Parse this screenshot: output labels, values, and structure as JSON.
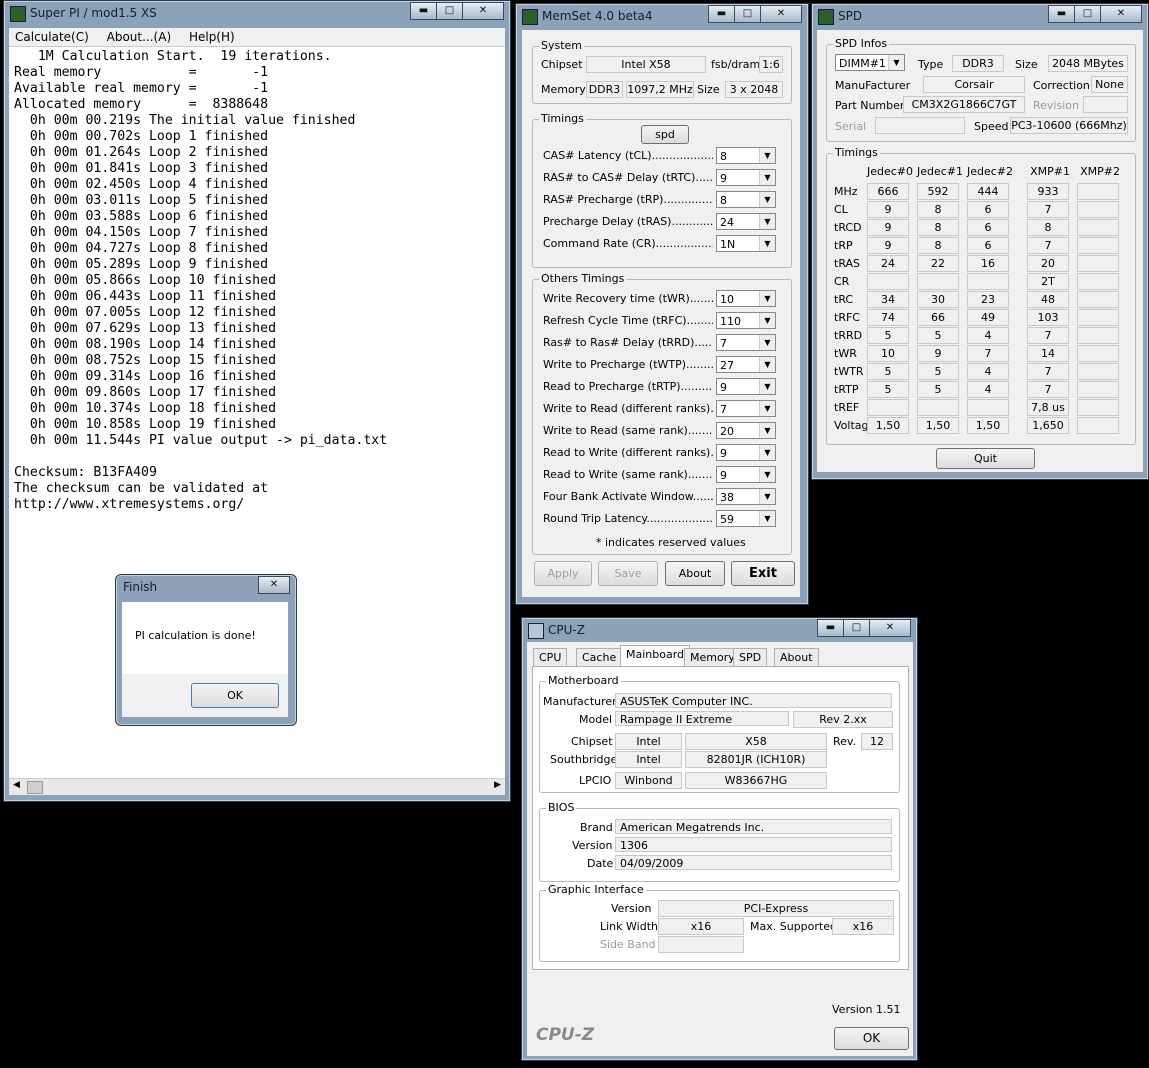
{
  "superpi": {
    "title": "Super PI / mod1.5 XS",
    "menu": [
      "Calculate(C)",
      "About...(A)",
      "Help(H)"
    ],
    "lines": [
      "   1M Calculation Start.  19 iterations.",
      "Real memory           =       -1",
      "Available real memory =       -1",
      "Allocated memory      =  8388648",
      "  0h 00m 00.219s The initial value finished",
      "  0h 00m 00.702s Loop 1 finished",
      "  0h 00m 01.264s Loop 2 finished",
      "  0h 00m 01.841s Loop 3 finished",
      "  0h 00m 02.450s Loop 4 finished",
      "  0h 00m 03.011s Loop 5 finished",
      "  0h 00m 03.588s Loop 6 finished",
      "  0h 00m 04.150s Loop 7 finished",
      "  0h 00m 04.727s Loop 8 finished",
      "  0h 00m 05.289s Loop 9 finished",
      "  0h 00m 05.866s Loop 10 finished",
      "  0h 00m 06.443s Loop 11 finished",
      "  0h 00m 07.005s Loop 12 finished",
      "  0h 00m 07.629s Loop 13 finished",
      "  0h 00m 08.190s Loop 14 finished",
      "  0h 00m 08.752s Loop 15 finished",
      "  0h 00m 09.314s Loop 16 finished",
      "  0h 00m 09.860s Loop 17 finished",
      "  0h 00m 10.374s Loop 18 finished",
      "  0h 00m 10.858s Loop 19 finished",
      "  0h 00m 11.544s PI value output -> pi_data.txt",
      "",
      "Checksum: B13FA409",
      "The checksum can be validated at",
      "http://www.xtremesystems.org/"
    ]
  },
  "finish": {
    "title": "Finish",
    "message": "PI calculation is done!",
    "ok": "OK"
  },
  "memset": {
    "title": "MemSet 4.0 beta4",
    "system": {
      "group": "System",
      "chipset_label": "Chipset",
      "chipset": "Intel X58",
      "fsb_label": "fsb/dram",
      "fsb": "1:6",
      "memory_label": "Memory",
      "memory_type": "DDR3",
      "memory_freq": "1097,2 MHz",
      "size_label": "Size",
      "size": "3 x 2048"
    },
    "timings": {
      "group": "Timings",
      "spd_button": "spd",
      "rows": [
        {
          "label": "CAS# Latency (tCL)",
          "value": "8"
        },
        {
          "label": "RAS# to CAS# Delay (tRTC)",
          "value": "9"
        },
        {
          "label": "RAS# Precharge (tRP)",
          "value": "8"
        },
        {
          "label": "Precharge Delay  (tRAS)",
          "value": "24"
        },
        {
          "label": "Command Rate (CR)",
          "value": "1N"
        }
      ]
    },
    "others": {
      "group": "Others Timings",
      "rows": [
        {
          "label": "Write Recovery time (tWR)",
          "value": "10"
        },
        {
          "label": "Refresh Cycle Time (tRFC)",
          "value": "110"
        },
        {
          "label": "Ras# to Ras# Delay (tRRD)",
          "value": "7"
        },
        {
          "label": "Write to Precharge (tWTP)",
          "value": "27"
        },
        {
          "label": "Read to Precharge (tRTP)",
          "value": "9"
        },
        {
          "label": "Write to Read (different ranks)",
          "value": "7"
        },
        {
          "label": "Write to Read (same rank)",
          "value": "20"
        },
        {
          "label": "Read to Write (different ranks)",
          "value": "9"
        },
        {
          "label": "Read to Write (same rank)",
          "value": "9"
        },
        {
          "label": "Four Bank Activate Window",
          "value": "38"
        },
        {
          "label": "Round Trip Latency",
          "value": "59"
        }
      ],
      "note": "* indicates reserved values"
    },
    "buttons": {
      "apply": "Apply",
      "save": "Save",
      "about": "About",
      "exit": "Exit"
    }
  },
  "spd": {
    "title": "SPD",
    "infos": {
      "group": "SPD Infos",
      "dimm": "DIMM#1",
      "type_label": "Type",
      "type": "DDR3",
      "size_label": "Size",
      "size": "2048 MBytes",
      "manufacturer_label": "ManuFacturer",
      "manufacturer": "Corsair",
      "correction_label": "Correction",
      "correction": "None",
      "part_label": "Part Number",
      "part": "CM3X2G1866C7GT",
      "revision_label": "Revision",
      "serial_label": "Serial",
      "speed_label": "Speed",
      "speed": "PC3-10600 (666Mhz)"
    },
    "timings": {
      "group": "Timings",
      "headers": [
        "Jedec#0",
        "Jedec#1",
        "Jedec#2",
        "XMP#1",
        "XMP#2"
      ],
      "rows": [
        {
          "label": "MHz",
          "values": [
            "666",
            "592",
            "444",
            "933",
            ""
          ]
        },
        {
          "label": "CL",
          "values": [
            "9",
            "8",
            "6",
            "7",
            ""
          ]
        },
        {
          "label": "tRCD",
          "values": [
            "9",
            "8",
            "6",
            "8",
            ""
          ]
        },
        {
          "label": "tRP",
          "values": [
            "9",
            "8",
            "6",
            "7",
            ""
          ]
        },
        {
          "label": "tRAS",
          "values": [
            "24",
            "22",
            "16",
            "20",
            ""
          ]
        },
        {
          "label": "CR",
          "values": [
            "",
            "",
            "",
            "2T",
            ""
          ]
        },
        {
          "label": "tRC",
          "values": [
            "34",
            "30",
            "23",
            "48",
            ""
          ]
        },
        {
          "label": "tRFC",
          "values": [
            "74",
            "66",
            "49",
            "103",
            ""
          ]
        },
        {
          "label": "tRRD",
          "values": [
            "5",
            "5",
            "4",
            "7",
            ""
          ]
        },
        {
          "label": "tWR",
          "values": [
            "10",
            "9",
            "7",
            "14",
            ""
          ]
        },
        {
          "label": "tWTR",
          "values": [
            "5",
            "5",
            "4",
            "7",
            ""
          ]
        },
        {
          "label": "tRTP",
          "values": [
            "5",
            "5",
            "4",
            "7",
            ""
          ]
        },
        {
          "label": "tREF",
          "values": [
            "",
            "",
            "",
            "7,8 us",
            ""
          ]
        },
        {
          "label": "Voltage",
          "values": [
            "1,50",
            "1,50",
            "1,50",
            "1,650",
            ""
          ]
        }
      ]
    },
    "quit": "Quit"
  },
  "cpuz": {
    "title": "CPU-Z",
    "tabs": [
      "CPU",
      "Cache",
      "Mainboard",
      "Memory",
      "SPD",
      "About"
    ],
    "active_tab": "Mainboard",
    "motherboard": {
      "group": "Motherboard",
      "manufacturer_label": "Manufacturer",
      "manufacturer": "ASUSTeK Computer INC.",
      "model_label": "Model",
      "model": "Rampage II Extreme",
      "model_rev": "Rev 2.xx",
      "chipset_label": "Chipset",
      "chipset_vendor": "Intel",
      "chipset": "X58",
      "rev_label": "Rev.",
      "rev": "12",
      "southbridge_label": "Southbridge",
      "sb_vendor": "Intel",
      "southbridge": "82801JR (ICH10R)",
      "lpcio_label": "LPCIO",
      "lpcio_vendor": "Winbond",
      "lpcio": "W83667HG"
    },
    "bios": {
      "group": "BIOS",
      "brand_label": "Brand",
      "brand": "American Megatrends Inc.",
      "version_label": "Version",
      "version": "1306",
      "date_label": "Date",
      "date": "04/09/2009"
    },
    "graphic": {
      "group": "Graphic Interface",
      "version_label": "Version",
      "version": "PCI-Express",
      "link_label": "Link Width",
      "link": "x16",
      "max_label": "Max. Supported",
      "max": "x16",
      "sideband_label": "Side Band"
    },
    "footer_version": "Version 1.51",
    "brand": "CPU-Z",
    "ok": "OK"
  }
}
